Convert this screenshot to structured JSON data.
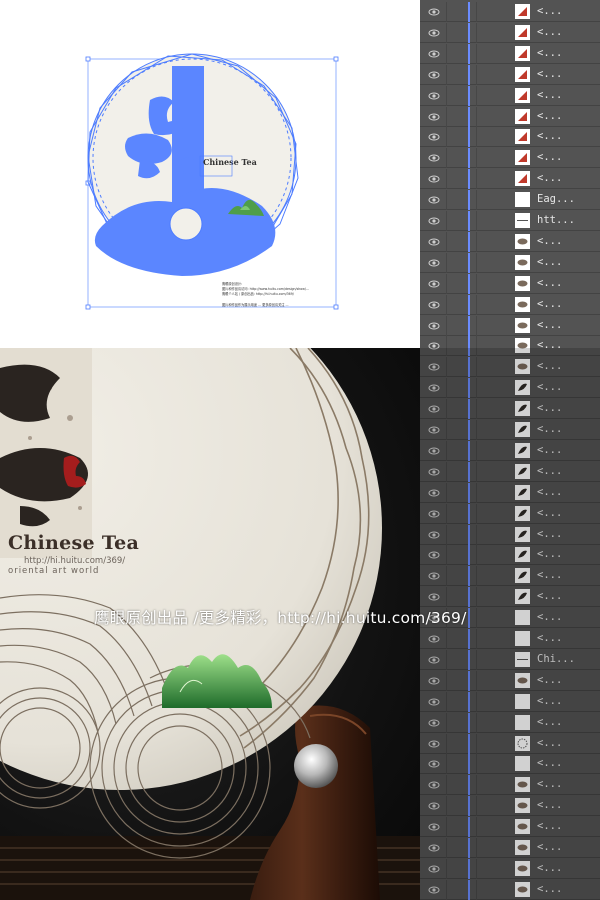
{
  "artboard": {
    "title_text": "Chinese Tea",
    "info_lines": [
      "鹰眼原创设计:",
      "图片和作品请访问: http://www.huitu.com/design/show/...",
      "鹰眼个人站 / 原创出品: http://hi.huitu.com/369/"
    ],
    "footer_line": "图片和作品作为展示用途 ... 更多原创请关注 ..."
  },
  "render": {
    "title": "Chinese Tea",
    "url": "http://hi.huitu.com/369/",
    "subtitle": "oriental art world"
  },
  "watermark": "鹰眼原创出品 /更多精彩，http://hi.huitu.com/369/",
  "layers": {
    "visible_icon": "eye-icon",
    "selection_color": "#6b8cff",
    "rows": [
      {
        "name": "<...",
        "thumb": "red-shape"
      },
      {
        "name": "<...",
        "thumb": "red-shape"
      },
      {
        "name": "<...",
        "thumb": "red-shape"
      },
      {
        "name": "<...",
        "thumb": "red-shape"
      },
      {
        "name": "<...",
        "thumb": "red-shape"
      },
      {
        "name": "<...",
        "thumb": "red-shape"
      },
      {
        "name": "<...",
        "thumb": "red-shape"
      },
      {
        "name": "<...",
        "thumb": "red-shape"
      },
      {
        "name": "<...",
        "thumb": "red-shape"
      },
      {
        "name": "Eag...",
        "thumb": "blank"
      },
      {
        "name": "htt...",
        "thumb": "line"
      },
      {
        "name": "<...",
        "thumb": "brown-shape"
      },
      {
        "name": "<...",
        "thumb": "brown-shape"
      },
      {
        "name": "<...",
        "thumb": "brown-shape"
      },
      {
        "name": "<...",
        "thumb": "brown-shape"
      },
      {
        "name": "<...",
        "thumb": "brown-shape"
      },
      {
        "name": "<...",
        "thumb": "brown-shape"
      },
      {
        "name": "<...",
        "thumb": "brown-shape"
      },
      {
        "name": "<...",
        "thumb": "dark-shape"
      },
      {
        "name": "<...",
        "thumb": "dark-shape"
      },
      {
        "name": "<...",
        "thumb": "dark-shape"
      },
      {
        "name": "<...",
        "thumb": "dark-shape"
      },
      {
        "name": "<...",
        "thumb": "dark-shape"
      },
      {
        "name": "<...",
        "thumb": "dark-shape"
      },
      {
        "name": "<...",
        "thumb": "dark-shape"
      },
      {
        "name": "<...",
        "thumb": "dark-shape"
      },
      {
        "name": "<...",
        "thumb": "dark-shape"
      },
      {
        "name": "<...",
        "thumb": "dark-shape"
      },
      {
        "name": "<...",
        "thumb": "dark-shape"
      },
      {
        "name": "<...",
        "thumb": "blank"
      },
      {
        "name": "<...",
        "thumb": "blank"
      },
      {
        "name": "Chi...",
        "thumb": "line"
      },
      {
        "name": "<...",
        "thumb": "brown-shape"
      },
      {
        "name": "<...",
        "thumb": "blank"
      },
      {
        "name": "<...",
        "thumb": "blank"
      },
      {
        "name": "<...",
        "thumb": "circle"
      },
      {
        "name": "<...",
        "thumb": "blank"
      },
      {
        "name": "<...",
        "thumb": "brown-shape"
      },
      {
        "name": "<...",
        "thumb": "brown-shape"
      },
      {
        "name": "<...",
        "thumb": "brown-shape"
      },
      {
        "name": "<...",
        "thumb": "brown-shape"
      },
      {
        "name": "<...",
        "thumb": "brown-shape"
      },
      {
        "name": "<...",
        "thumb": "brown-shape"
      },
      {
        "name": "<...",
        "thumb": "brown-shape"
      }
    ]
  }
}
